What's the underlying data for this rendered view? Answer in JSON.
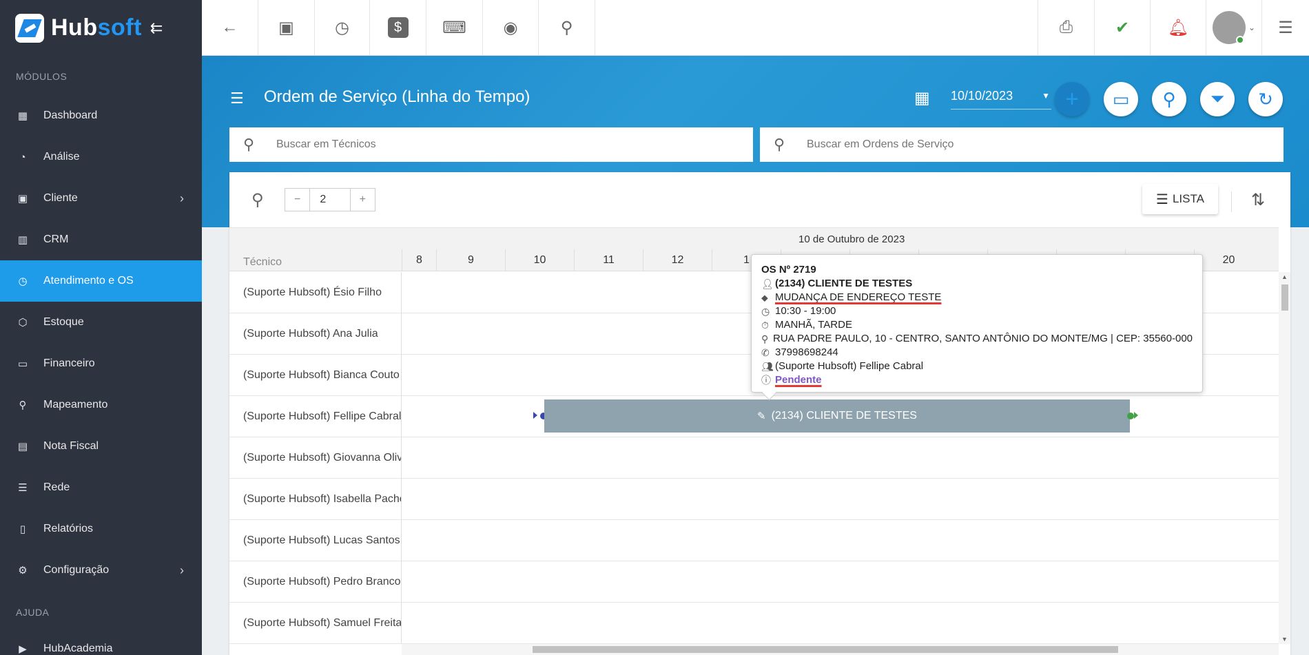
{
  "app": {
    "logo_hub": "Hub",
    "logo_soft": "soft"
  },
  "sidebar": {
    "section_modules": "MÓDULOS",
    "section_help": "AJUDA",
    "items": [
      {
        "label": "Dashboard",
        "icon": "dashboard-icon"
      },
      {
        "label": "Análise",
        "icon": "pie-chart-icon"
      },
      {
        "label": "Cliente",
        "icon": "contact-icon",
        "has_children": true
      },
      {
        "label": "CRM",
        "icon": "kanban-icon"
      },
      {
        "label": "Atendimento e OS",
        "icon": "calendar-clock-icon",
        "active": true
      },
      {
        "label": "Estoque",
        "icon": "box-icon"
      },
      {
        "label": "Financeiro",
        "icon": "money-icon"
      },
      {
        "label": "Mapeamento",
        "icon": "map-pin-icon"
      },
      {
        "label": "Nota Fiscal",
        "icon": "receipt-icon"
      },
      {
        "label": "Rede",
        "icon": "network-icon"
      },
      {
        "label": "Relatórios",
        "icon": "document-icon"
      },
      {
        "label": "Configuração",
        "icon": "gear-icon",
        "has_children": true
      }
    ],
    "help_items": [
      {
        "label": "HubAcademia",
        "icon": "play-icon"
      }
    ]
  },
  "topbar": {
    "icons": [
      "back-arrow-icon",
      "contact-card-icon",
      "calendar-clock-icon",
      "dollar-icon",
      "terminal-icon",
      "eye-icon",
      "search-icon"
    ],
    "right_icons": [
      "pdf-icon",
      "chat-check-icon",
      "bell-icon",
      "user-avatar",
      "list-icon"
    ]
  },
  "header": {
    "title": "Ordem de Serviço (Linha do Tempo)",
    "date": "10/10/2023",
    "search_tecnicos_placeholder": "Buscar em Técnicos",
    "search_os_placeholder": "Buscar em Ordens de Serviço"
  },
  "toolbar": {
    "zoom_value": "2",
    "lista_label": "LISTA"
  },
  "timeline": {
    "date_label": "10 de Outubro de 2023",
    "tecnico_header": "Técnico",
    "hours": [
      "8",
      "9",
      "10",
      "11",
      "12",
      "1",
      "",
      "",
      "",
      "",
      "",
      "",
      "20"
    ],
    "tecnicos": [
      "(Suporte Hubsoft) Ésio Filho",
      "(Suporte Hubsoft) Ana Julia",
      "(Suporte Hubsoft) Bianca Couto",
      "(Suporte Hubsoft) Fellipe Cabral",
      "(Suporte Hubsoft) Giovanna Olive",
      "(Suporte Hubsoft) Isabella Pache",
      "(Suporte Hubsoft) Lucas Santos",
      "(Suporte Hubsoft) Pedro Branco",
      "(Suporte Hubsoft) Samuel Freita"
    ],
    "event_label": "(2134) CLIENTE DE TESTES"
  },
  "tooltip": {
    "os_number": "OS Nº 2719",
    "client": "(2134) CLIENTE DE TESTES",
    "service": "MUDANÇA DE ENDEREÇO TESTE",
    "time": "10:30 - 19:00",
    "period": "MANHÃ, TARDE",
    "address": "RUA PADRE PAULO, 10 - CENTRO, SANTO ANTÔNIO DO MONTE/MG | CEP: 35560-000",
    "phone": "37998698244",
    "tecnico": "(Suporte Hubsoft) Fellipe Cabral",
    "status": "Pendente"
  }
}
